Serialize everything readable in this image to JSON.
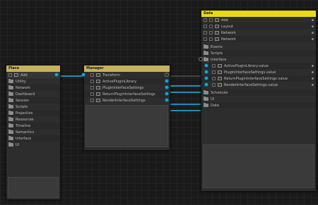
{
  "colors": {
    "wire": "#2bb3e0",
    "first_header": "#c7b15a",
    "second_header": "#c7b15a",
    "third_header": "#e8d81a"
  },
  "node_first": {
    "title": "Place",
    "rows": [
      "Add",
      "Utility",
      "Network",
      "Dashboard",
      "Session",
      "Scripts",
      "Projection",
      "Resources",
      "Timeline",
      "Semantics",
      "Interface",
      "UI"
    ]
  },
  "node_second": {
    "title": "Manager",
    "rows": [
      "Transform",
      "ActivePluginLibrary",
      "PluginInterfaceSettings",
      "ReturnPluginInterfaceSettings",
      "RenderInterfaceSettings"
    ]
  },
  "node_third": {
    "title": "Data",
    "top_rows": [
      "Add",
      "Layout",
      "Network",
      "Network"
    ],
    "folders_a": [
      "Events",
      "Scripts",
      "Interface"
    ],
    "sub_rows": [
      "ActivePluginLibrary.value",
      "PluginInterfaceSettings.value",
      "ReturnPluginInterfaceSettings.value",
      "RenderInterfaceSettings.value"
    ],
    "folders_b": [
      "Scheduler",
      "UI",
      "Data"
    ]
  }
}
